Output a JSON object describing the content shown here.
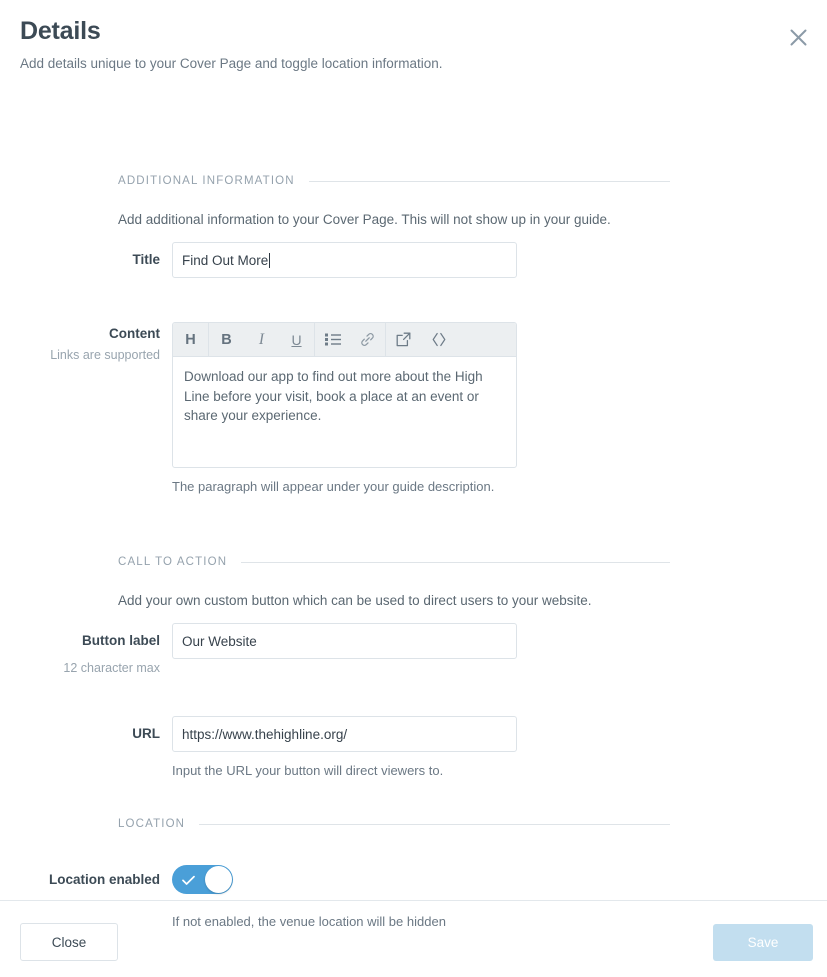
{
  "header": {
    "title": "Details",
    "subtitle": "Add details unique to your Cover Page and toggle location information.",
    "close_icon": "close-icon"
  },
  "sections": {
    "additional_information": {
      "label": "ADDITIONAL INFORMATION",
      "description": "Add additional information to your Cover Page. This will not show up in your guide.",
      "title_field": {
        "label": "Title",
        "value": "Find Out More",
        "placeholder": "Title"
      },
      "content_field": {
        "label": "Content",
        "sublabel": "Links are supported",
        "value": "Download our app to find out more about the High Line before your visit, book a place at an event or share your experience.",
        "help": "The paragraph will appear under your guide description.",
        "toolbar": [
          {
            "name": "heading-icon",
            "label": "H"
          },
          {
            "name": "bold-icon",
            "label": "B"
          },
          {
            "name": "italic-icon",
            "label": "I"
          },
          {
            "name": "underline-icon",
            "label": "U"
          },
          {
            "name": "bulleted-list-icon",
            "label": ""
          },
          {
            "name": "link-icon",
            "label": ""
          },
          {
            "name": "external-link-icon",
            "label": ""
          },
          {
            "name": "code-icon",
            "label": ""
          }
        ]
      }
    },
    "call_to_action": {
      "label": "CALL TO ACTION",
      "description": "Add your own custom button which can be used to direct users to your website.",
      "button_label_field": {
        "label": "Button label",
        "sublabel": "12 character max",
        "value": "Our Website",
        "placeholder": "Button label"
      },
      "url_field": {
        "label": "URL",
        "value": "https://www.thehighline.org/",
        "placeholder": "URL",
        "help": "Input the URL your button will direct viewers to."
      }
    },
    "location": {
      "label": "LOCATION",
      "toggle_field": {
        "label": "Location enabled",
        "enabled": true,
        "help": "If not enabled, the venue location will be hidden"
      }
    }
  },
  "footer": {
    "close_label": "Close",
    "save_label": "Save"
  },
  "colors": {
    "accent": "#4a9fd8",
    "save_disabled": "#c2deef",
    "text_dark": "#3c4a55",
    "text_muted": "#6b7884",
    "border": "#dde3e8"
  }
}
